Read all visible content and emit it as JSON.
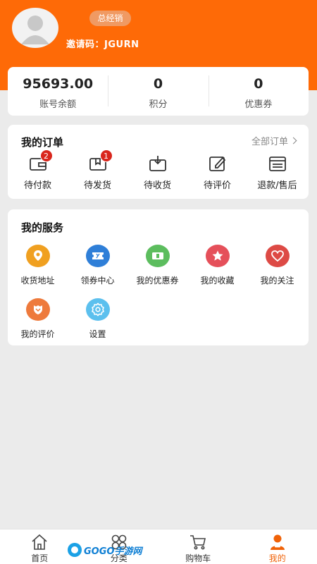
{
  "header": {
    "role": "总经销",
    "invite": "邀请码：JGURN"
  },
  "stats": [
    {
      "value": "95693.00",
      "label": "账号余额"
    },
    {
      "value": "0",
      "label": "积分"
    },
    {
      "value": "0",
      "label": "优惠券"
    }
  ],
  "orders": {
    "title": "我的订单",
    "all_label": "全部订单",
    "items": [
      {
        "label": "待付款",
        "icon": "wallet-icon",
        "badge": "2"
      },
      {
        "label": "待发货",
        "icon": "package-icon",
        "badge": "1"
      },
      {
        "label": "待收货",
        "icon": "inbox-download-icon",
        "badge": ""
      },
      {
        "label": "待评价",
        "icon": "edit-icon",
        "badge": ""
      },
      {
        "label": "退款/售后",
        "icon": "list-doc-icon",
        "badge": ""
      }
    ]
  },
  "services": {
    "title": "我的服务",
    "items": [
      {
        "label": "收货地址",
        "icon": "location-icon",
        "color": "#f0a020"
      },
      {
        "label": "领券中心",
        "icon": "ticket-icon",
        "color": "#2f7fd8"
      },
      {
        "label": "我的优惠券",
        "icon": "coupon-icon",
        "color": "#5cbd5e"
      },
      {
        "label": "我的收藏",
        "icon": "star-icon",
        "color": "#e5505a"
      },
      {
        "label": "我的关注",
        "icon": "heart-icon",
        "color": "#dd4a45"
      },
      {
        "label": "我的评价",
        "icon": "comment-icon",
        "color": "#ee7a3c"
      },
      {
        "label": "设置",
        "icon": "gear-icon",
        "color": "#5cc0ee"
      }
    ]
  },
  "tabbar": [
    {
      "label": "首页",
      "icon": "home-icon",
      "active": false
    },
    {
      "label": "分类",
      "icon": "category-icon",
      "active": false
    },
    {
      "label": "购物车",
      "icon": "cart-icon",
      "active": false
    },
    {
      "label": "我的",
      "icon": "user-icon",
      "active": true
    }
  ],
  "watermark": "GOGO手游网",
  "colors": {
    "brand": "#fe6a07",
    "badge": "#d9261c",
    "active_tab": "#f06208"
  }
}
